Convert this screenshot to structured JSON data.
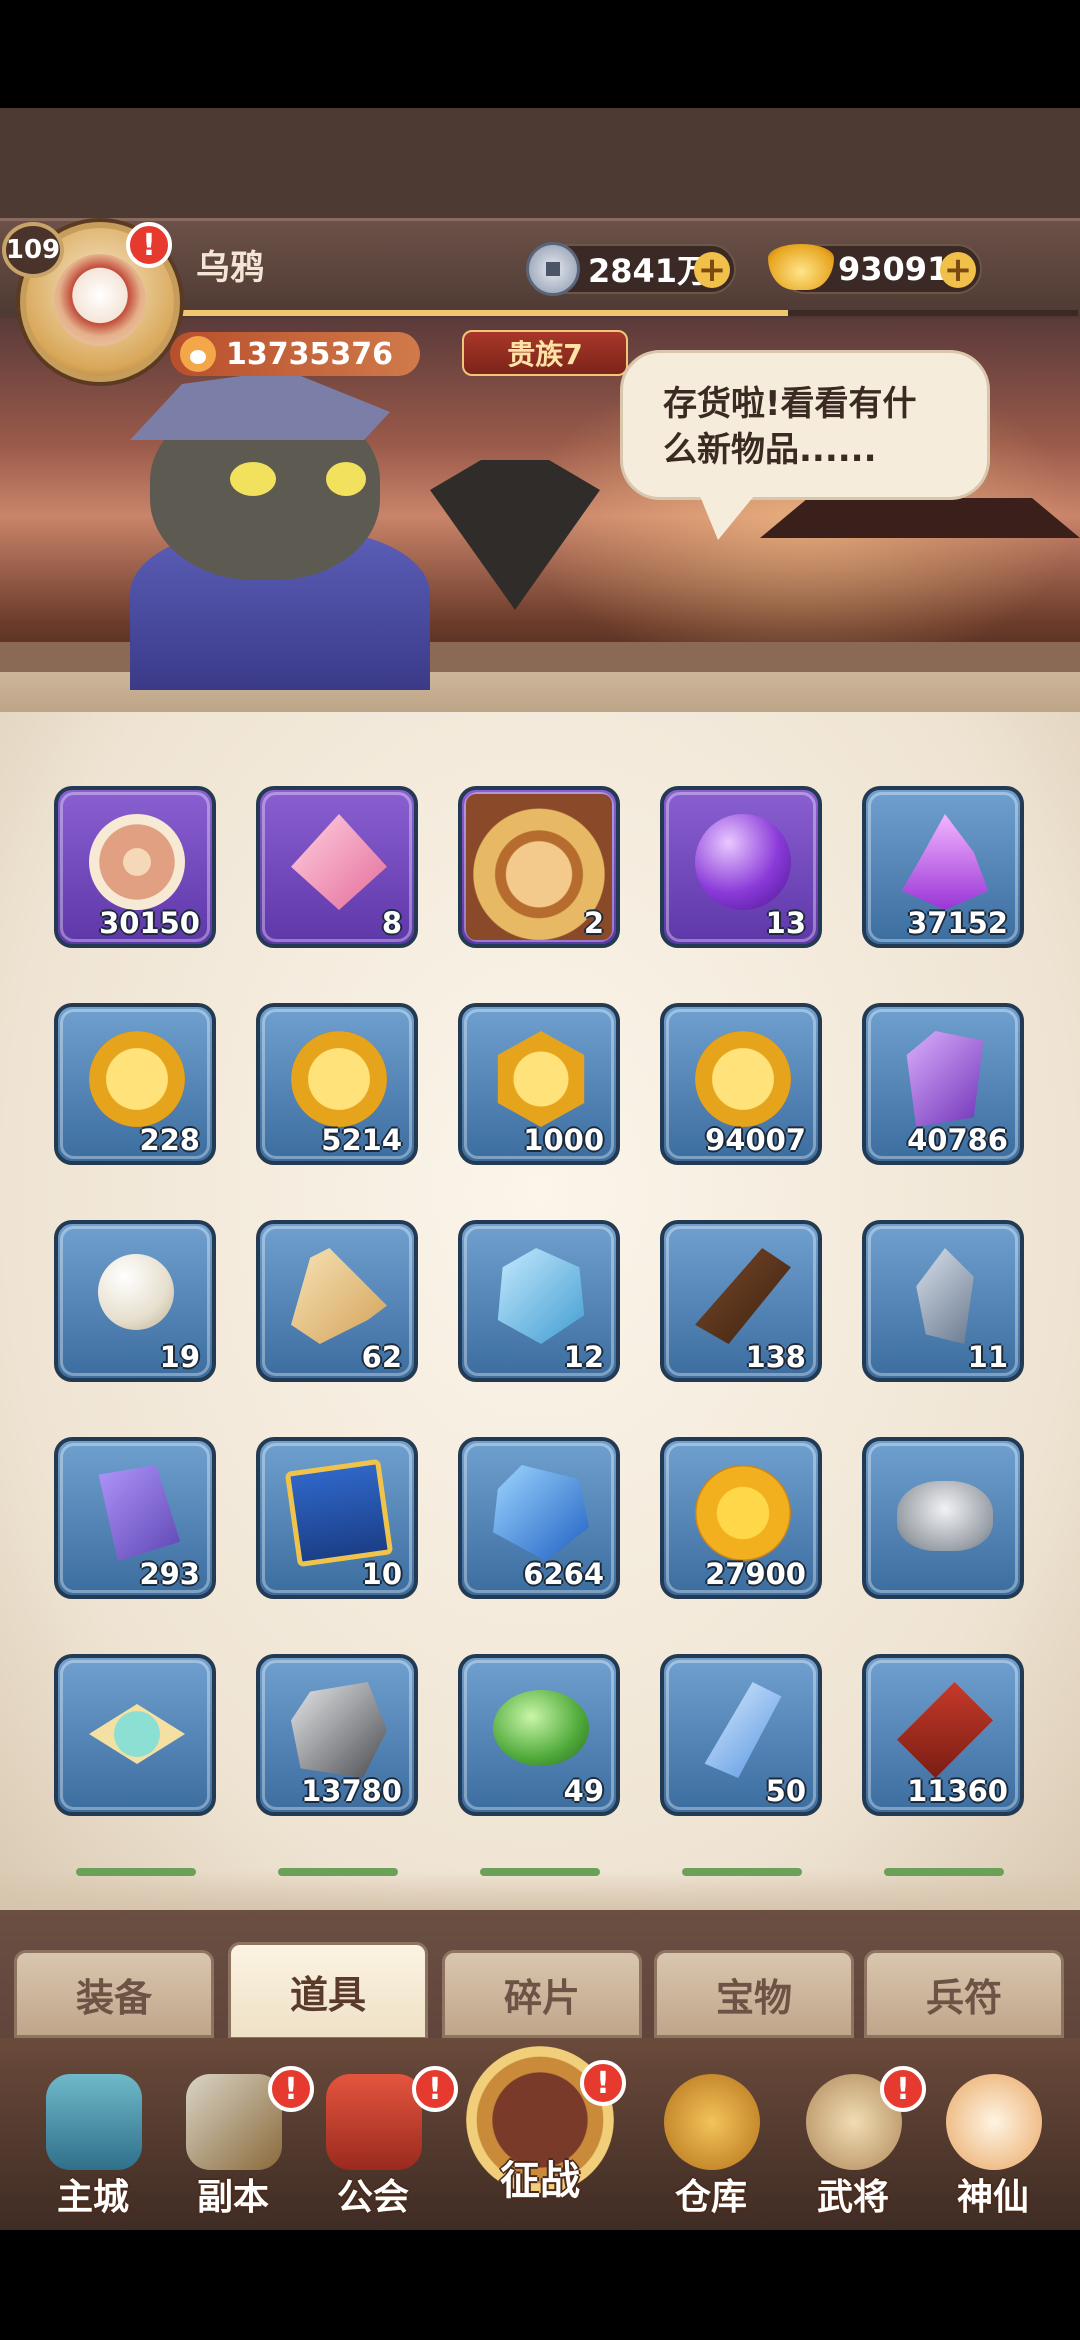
{
  "player": {
    "level": "109",
    "name": "乌鸦",
    "power": "13735376",
    "noble": "贵族7"
  },
  "resources": {
    "silver_coins": "2841万",
    "gold_ingots": "93091"
  },
  "banner": {
    "speech": "存货啦!看看有什么新物品......"
  },
  "inventory": [
    {
      "icon": "wheel-charm-icon",
      "count": "30150"
    },
    {
      "icon": "pink-gem-icon",
      "count": "8"
    },
    {
      "icon": "hero-portrait-icon",
      "count": "2"
    },
    {
      "icon": "purple-orb-icon",
      "count": "13"
    },
    {
      "icon": "purple-flame-icon",
      "count": "37152"
    },
    {
      "icon": "gold-coin-icon",
      "count": "228"
    },
    {
      "icon": "skull-coin-icon",
      "count": "5214"
    },
    {
      "icon": "star-medal-icon",
      "count": "1000"
    },
    {
      "icon": "lightning-coin-icon",
      "count": "94007"
    },
    {
      "icon": "purple-crystal-icon",
      "count": "40786"
    },
    {
      "icon": "pearl-icon",
      "count": "19"
    },
    {
      "icon": "scroll-icon",
      "count": "62"
    },
    {
      "icon": "blue-rune-icon",
      "count": "12"
    },
    {
      "icon": "wood-log-icon",
      "count": "138"
    },
    {
      "icon": "silver-shard-icon",
      "count": "11"
    },
    {
      "icon": "challenge-book-icon",
      "count": "293"
    },
    {
      "icon": "merit-card-icon",
      "count": "10"
    },
    {
      "icon": "blue-gem-icon",
      "count": "6264"
    },
    {
      "icon": "sun-coin-icon",
      "count": "27900"
    },
    {
      "icon": "silver-ingot-icon",
      "count": ""
    },
    {
      "icon": "jade-cloud-icon",
      "count": ""
    },
    {
      "icon": "iron-stone-icon",
      "count": "13780"
    },
    {
      "icon": "green-gem-icon",
      "count": "49"
    },
    {
      "icon": "blue-prism-icon",
      "count": "50"
    },
    {
      "icon": "firework-icon",
      "count": "11360"
    }
  ],
  "tabs": [
    "装备",
    "道具",
    "碎片",
    "宝物",
    "兵符"
  ],
  "nav": {
    "city": "主城",
    "dungeon": "副本",
    "guild": "公会",
    "battle": "征战",
    "warehouse": "仓库",
    "generals": "武将",
    "immortal": "神仙"
  },
  "alert_mark": "!",
  "plus_mark": "+"
}
